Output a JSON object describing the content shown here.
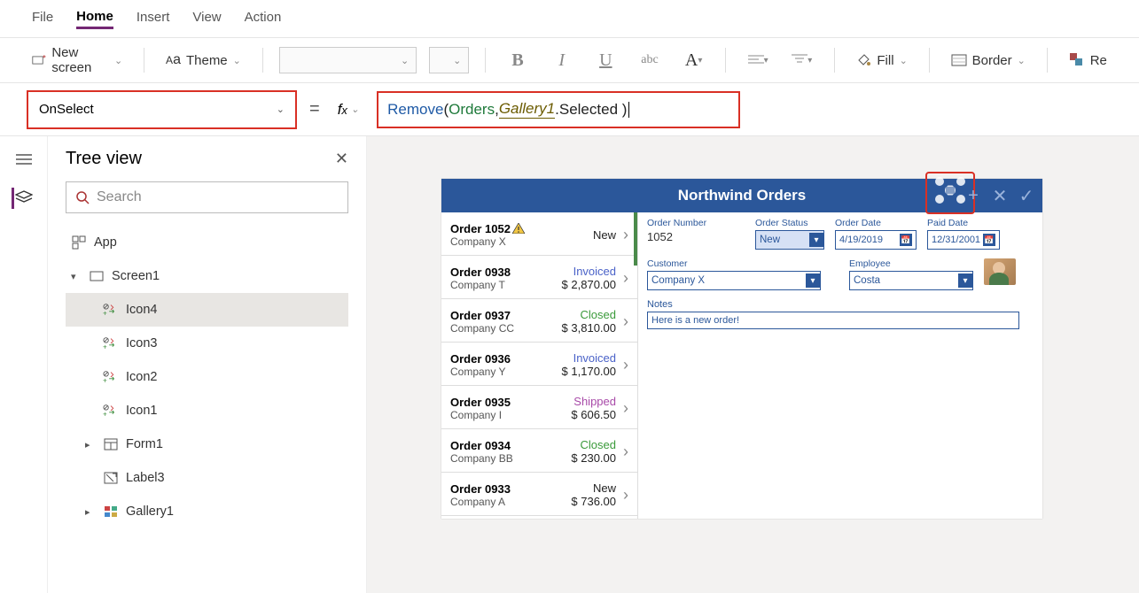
{
  "menu": {
    "file": "File",
    "home": "Home",
    "insert": "Insert",
    "view": "View",
    "action": "Action"
  },
  "ribbon": {
    "new_screen": "New screen",
    "theme": "Theme",
    "fill": "Fill",
    "border": "Border",
    "reorder_fragment": "Re"
  },
  "formula": {
    "property": "OnSelect",
    "fn": "Remove",
    "ds": "Orders",
    "ctl": "Gallery1",
    "suffix": ".Selected )"
  },
  "treeview": {
    "title": "Tree view",
    "search_placeholder": "Search",
    "app": "App",
    "screen": "Screen1",
    "items": [
      "Icon4",
      "Icon3",
      "Icon2",
      "Icon1",
      "Form1",
      "Label3",
      "Gallery1"
    ]
  },
  "preview": {
    "title": "Northwind Orders",
    "gallery": [
      {
        "order": "Order 1052",
        "company": "Company X",
        "status": "New",
        "amount": "",
        "warn": true
      },
      {
        "order": "Order 0938",
        "company": "Company T",
        "status": "Invoiced",
        "amount": "$ 2,870.00"
      },
      {
        "order": "Order 0937",
        "company": "Company CC",
        "status": "Closed",
        "amount": "$ 3,810.00"
      },
      {
        "order": "Order 0936",
        "company": "Company Y",
        "status": "Invoiced",
        "amount": "$ 1,170.00"
      },
      {
        "order": "Order 0935",
        "company": "Company I",
        "status": "Shipped",
        "amount": "$ 606.50"
      },
      {
        "order": "Order 0934",
        "company": "Company BB",
        "status": "Closed",
        "amount": "$ 230.00"
      },
      {
        "order": "Order 0933",
        "company": "Company A",
        "status": "New",
        "amount": "$ 736.00"
      }
    ],
    "form": {
      "order_number_label": "Order Number",
      "order_number": "1052",
      "order_status_label": "Order Status",
      "order_status": "New",
      "order_date_label": "Order Date",
      "order_date": "4/19/2019",
      "paid_date_label": "Paid Date",
      "paid_date": "12/31/2001",
      "customer_label": "Customer",
      "customer": "Company X",
      "employee_label": "Employee",
      "employee": "Costa",
      "notes_label": "Notes",
      "notes": "Here is a new order!"
    }
  }
}
